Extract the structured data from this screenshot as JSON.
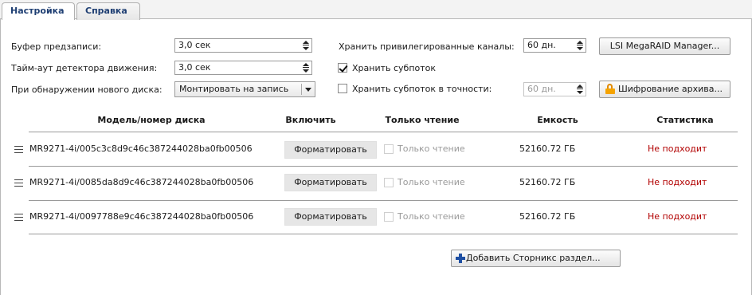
{
  "tabs": [
    {
      "label": "Настройка",
      "active": true
    },
    {
      "label": "Справка",
      "active": false
    }
  ],
  "settings": {
    "prebuffer_label": "Буфер предзаписи:",
    "prebuffer_value": "3,0 сек",
    "motion_timeout_label": "Тайм-аут детектора движения:",
    "motion_timeout_value": "3,0 сек",
    "new_disk_label": "При обнаружении нового диска:",
    "new_disk_value": "Монтировать на запись",
    "privileged_label": "Хранить привилегированные каналы:",
    "privileged_value": "60 дн.",
    "keep_substream_label": "Хранить субпоток",
    "keep_substream_checked": true,
    "keep_substream_exact_label": "Хранить субпоток в точности:",
    "keep_substream_exact_checked": false,
    "keep_substream_exact_value": "60 дн.",
    "lsi_button": "LSI MegaRAID Manager...",
    "encrypt_button": "Шифрование архива..."
  },
  "table": {
    "headers": [
      "Модель/номер диска",
      "Включить",
      "Только чтение",
      "Емкость",
      "Статистика"
    ],
    "rows": [
      {
        "model": "MR9271-4i/005c3c8d9c46c387244028ba0fb00506",
        "action": "Форматировать",
        "readonly": "Только чтение",
        "capacity": "52160.72 ГБ",
        "status": "Не подходит"
      },
      {
        "model": "MR9271-4i/0085da8d9c46c387244028ba0fb00506",
        "action": "Форматировать",
        "readonly": "Только чтение",
        "capacity": "52160.72 ГБ",
        "status": "Не подходит"
      },
      {
        "model": "MR9271-4i/0097788e9c46c387244028ba0fb00506",
        "action": "Форматировать",
        "readonly": "Только чтение",
        "capacity": "52160.72 ГБ",
        "status": "Не подходит"
      }
    ]
  },
  "add_button": "Добавить Сторникс раздел...",
  "colors": {
    "tab_text": "#1f3f73",
    "status_red": "#b20000",
    "plus_blue": "#1e4fa3",
    "lock_orange": "#f5a300"
  }
}
